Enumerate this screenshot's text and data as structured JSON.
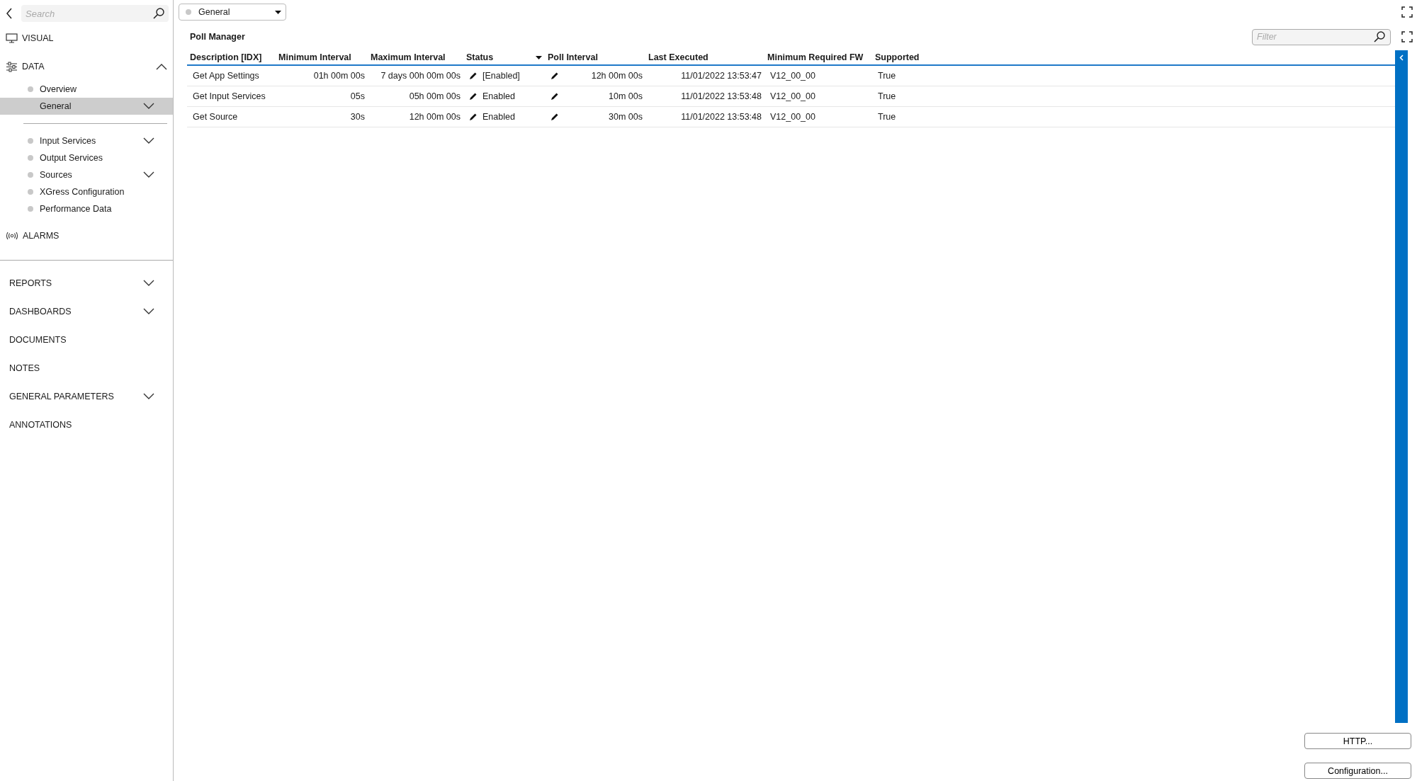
{
  "sidebar": {
    "search": {
      "placeholder": "Search"
    },
    "nav": [
      {
        "label": "VISUAL",
        "kind": "monitor"
      },
      {
        "label": "DATA",
        "kind": "sliders",
        "expanded": true,
        "groups": [
          [
            {
              "label": "Overview",
              "kind": "leaf",
              "selected": false
            },
            {
              "label": "General",
              "kind": "expandable",
              "expanded": false,
              "selected": true
            }
          ],
          [
            {
              "label": "Input Services",
              "kind": "expandable",
              "expanded": false,
              "selected": false
            },
            {
              "label": "Output Services",
              "kind": "leaf",
              "selected": false
            },
            {
              "label": "Sources",
              "kind": "expandable",
              "expanded": false,
              "selected": false
            },
            {
              "label": "XGress Configuration",
              "kind": "leaf",
              "selected": false
            },
            {
              "label": "Performance Data",
              "kind": "leaf",
              "selected": false
            }
          ]
        ]
      },
      {
        "label": "ALARMS",
        "kind": "signal"
      }
    ],
    "modules": [
      {
        "label": "REPORTS",
        "kind": "expandable",
        "expanded": false
      },
      {
        "label": "DASHBOARDS",
        "kind": "expandable",
        "expanded": false
      },
      {
        "label": "DOCUMENTS",
        "kind": "leaf"
      },
      {
        "label": "NOTES",
        "kind": "leaf"
      },
      {
        "label": "GENERAL PARAMETERS",
        "kind": "expandable",
        "expanded": false
      },
      {
        "label": "ANNOTATIONS",
        "kind": "leaf"
      }
    ]
  },
  "selector": {
    "value": "General"
  },
  "panel": {
    "title": "Poll Manager",
    "filter": {
      "placeholder": "Filter"
    }
  },
  "table": {
    "columns": [
      {
        "label": "Description [IDX]",
        "kind": "text",
        "sorted": false
      },
      {
        "label": "Minimum Interval",
        "kind": "number",
        "sorted": false
      },
      {
        "label": "Maximum Interval",
        "kind": "number",
        "sorted": false
      },
      {
        "label": "Status",
        "kind": "editable",
        "sorted": true
      },
      {
        "label": "Poll Interval",
        "kind": "editablenumber",
        "sorted": false
      },
      {
        "label": "Last Executed",
        "kind": "number",
        "sorted": false
      },
      {
        "label": "Minimum Required FW",
        "kind": "text",
        "sorted": false
      },
      {
        "label": "Supported",
        "kind": "text",
        "sorted": false
      }
    ],
    "rows": [
      [
        "Get App Settings",
        "01h 00m 00s",
        "7 days 00h 00m 00s",
        "[Enabled]",
        "12h 00m 00s",
        "11/01/2022 13:53:47",
        "V12_00_00",
        "True"
      ],
      [
        "Get Input Services",
        "05s",
        "05h 00m 00s",
        "Enabled",
        "10m 00s",
        "11/01/2022 13:53:48",
        "V12_00_00",
        "True"
      ],
      [
        "Get Source",
        "30s",
        "12h 00m 00s",
        "Enabled",
        "30m 00s",
        "11/01/2022 13:53:48",
        "V12_00_00",
        "True"
      ]
    ]
  },
  "buttons": [
    "HTTP...",
    "Configuration..."
  ]
}
